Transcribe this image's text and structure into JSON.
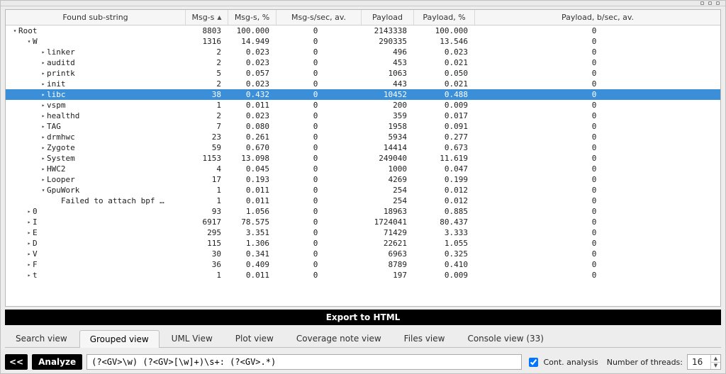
{
  "columns": [
    "Found sub-string",
    "Msg-s",
    "Msg-s, %",
    "Msg-s/sec, av.",
    "Payload",
    "Payload, %",
    "Payload, b/sec, av."
  ],
  "sort_column_index": 1,
  "sort_order": "asc",
  "selected_row_name": "libc",
  "rows": [
    {
      "depth": 0,
      "expander": "open",
      "name": "Root",
      "msgs": "8803",
      "msgs_pct": "100.000",
      "msgs_sec": "0",
      "payload": "2143338",
      "payload_pct": "100.000",
      "payload_sec": "0"
    },
    {
      "depth": 1,
      "expander": "open",
      "name": "W",
      "msgs": "1316",
      "msgs_pct": "14.949",
      "msgs_sec": "0",
      "payload": "290335",
      "payload_pct": "13.546",
      "payload_sec": "0"
    },
    {
      "depth": 2,
      "expander": "closed",
      "name": "linker",
      "msgs": "2",
      "msgs_pct": "0.023",
      "msgs_sec": "0",
      "payload": "496",
      "payload_pct": "0.023",
      "payload_sec": "0"
    },
    {
      "depth": 2,
      "expander": "closed",
      "name": "auditd",
      "msgs": "2",
      "msgs_pct": "0.023",
      "msgs_sec": "0",
      "payload": "453",
      "payload_pct": "0.021",
      "payload_sec": "0"
    },
    {
      "depth": 2,
      "expander": "closed",
      "name": "printk",
      "msgs": "5",
      "msgs_pct": "0.057",
      "msgs_sec": "0",
      "payload": "1063",
      "payload_pct": "0.050",
      "payload_sec": "0"
    },
    {
      "depth": 2,
      "expander": "closed",
      "name": "init",
      "msgs": "2",
      "msgs_pct": "0.023",
      "msgs_sec": "0",
      "payload": "443",
      "payload_pct": "0.021",
      "payload_sec": "0"
    },
    {
      "depth": 2,
      "expander": "closed",
      "name": "libc",
      "msgs": "38",
      "msgs_pct": "0.432",
      "msgs_sec": "0",
      "payload": "10452",
      "payload_pct": "0.488",
      "payload_sec": "0",
      "selected": true
    },
    {
      "depth": 2,
      "expander": "closed",
      "name": "vspm",
      "msgs": "1",
      "msgs_pct": "0.011",
      "msgs_sec": "0",
      "payload": "200",
      "payload_pct": "0.009",
      "payload_sec": "0"
    },
    {
      "depth": 2,
      "expander": "closed",
      "name": "healthd",
      "msgs": "2",
      "msgs_pct": "0.023",
      "msgs_sec": "0",
      "payload": "359",
      "payload_pct": "0.017",
      "payload_sec": "0"
    },
    {
      "depth": 2,
      "expander": "closed",
      "name": "TAG",
      "msgs": "7",
      "msgs_pct": "0.080",
      "msgs_sec": "0",
      "payload": "1958",
      "payload_pct": "0.091",
      "payload_sec": "0"
    },
    {
      "depth": 2,
      "expander": "closed",
      "name": "drmhwc",
      "msgs": "23",
      "msgs_pct": "0.261",
      "msgs_sec": "0",
      "payload": "5934",
      "payload_pct": "0.277",
      "payload_sec": "0"
    },
    {
      "depth": 2,
      "expander": "closed",
      "name": "Zygote",
      "msgs": "59",
      "msgs_pct": "0.670",
      "msgs_sec": "0",
      "payload": "14414",
      "payload_pct": "0.673",
      "payload_sec": "0"
    },
    {
      "depth": 2,
      "expander": "closed",
      "name": "System",
      "msgs": "1153",
      "msgs_pct": "13.098",
      "msgs_sec": "0",
      "payload": "249040",
      "payload_pct": "11.619",
      "payload_sec": "0"
    },
    {
      "depth": 2,
      "expander": "closed",
      "name": "HWC2",
      "msgs": "4",
      "msgs_pct": "0.045",
      "msgs_sec": "0",
      "payload": "1000",
      "payload_pct": "0.047",
      "payload_sec": "0"
    },
    {
      "depth": 2,
      "expander": "closed",
      "name": "Looper",
      "msgs": "17",
      "msgs_pct": "0.193",
      "msgs_sec": "0",
      "payload": "4269",
      "payload_pct": "0.199",
      "payload_sec": "0"
    },
    {
      "depth": 2,
      "expander": "open",
      "name": "GpuWork",
      "msgs": "1",
      "msgs_pct": "0.011",
      "msgs_sec": "0",
      "payload": "254",
      "payload_pct": "0.012",
      "payload_sec": "0"
    },
    {
      "depth": 3,
      "expander": "none",
      "name": "Failed to attach bpf …",
      "msgs": "1",
      "msgs_pct": "0.011",
      "msgs_sec": "0",
      "payload": "254",
      "payload_pct": "0.012",
      "payload_sec": "0"
    },
    {
      "depth": 1,
      "expander": "closed",
      "name": "0",
      "msgs": "93",
      "msgs_pct": "1.056",
      "msgs_sec": "0",
      "payload": "18963",
      "payload_pct": "0.885",
      "payload_sec": "0"
    },
    {
      "depth": 1,
      "expander": "closed",
      "name": "I",
      "msgs": "6917",
      "msgs_pct": "78.575",
      "msgs_sec": "0",
      "payload": "1724041",
      "payload_pct": "80.437",
      "payload_sec": "0"
    },
    {
      "depth": 1,
      "expander": "closed",
      "name": "E",
      "msgs": "295",
      "msgs_pct": "3.351",
      "msgs_sec": "0",
      "payload": "71429",
      "payload_pct": "3.333",
      "payload_sec": "0"
    },
    {
      "depth": 1,
      "expander": "closed",
      "name": "D",
      "msgs": "115",
      "msgs_pct": "1.306",
      "msgs_sec": "0",
      "payload": "22621",
      "payload_pct": "1.055",
      "payload_sec": "0"
    },
    {
      "depth": 1,
      "expander": "closed",
      "name": "V",
      "msgs": "30",
      "msgs_pct": "0.341",
      "msgs_sec": "0",
      "payload": "6963",
      "payload_pct": "0.325",
      "payload_sec": "0"
    },
    {
      "depth": 1,
      "expander": "closed",
      "name": "F",
      "msgs": "36",
      "msgs_pct": "0.409",
      "msgs_sec": "0",
      "payload": "8789",
      "payload_pct": "0.410",
      "payload_sec": "0"
    },
    {
      "depth": 1,
      "expander": "closed",
      "name": "t",
      "msgs": "1",
      "msgs_pct": "0.011",
      "msgs_sec": "0",
      "payload": "197",
      "payload_pct": "0.009",
      "payload_sec": "0"
    }
  ],
  "export_label": "Export to HTML",
  "tabs": [
    {
      "label": "Search view",
      "active": false
    },
    {
      "label": "Grouped view",
      "active": true
    },
    {
      "label": "UML View",
      "active": false
    },
    {
      "label": "Plot view",
      "active": false
    },
    {
      "label": "Coverage note view",
      "active": false
    },
    {
      "label": "Files view",
      "active": false
    },
    {
      "label": "Console view (33)",
      "active": false
    }
  ],
  "bottom": {
    "back_label": "<<",
    "analyze_label": "Analyze",
    "regex_value": "(?<GV>\\w) (?<GV>[\\w]+)\\s+: (?<GV>.*)",
    "cont_label": "Cont. analysis",
    "cont_checked": true,
    "threads_label": "Number of threads:",
    "threads_value": "16"
  }
}
